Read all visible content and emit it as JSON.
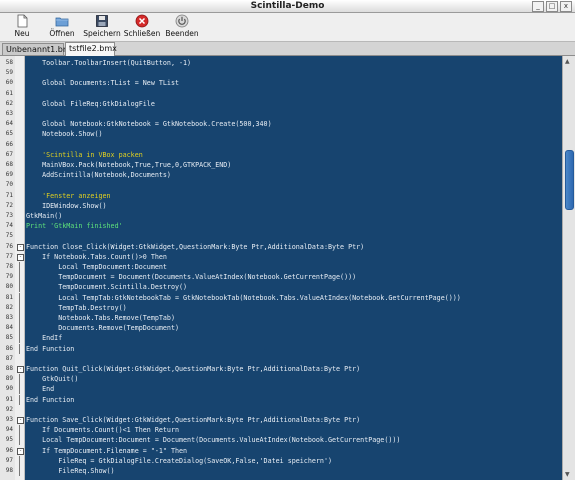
{
  "window": {
    "title": "Scintilla-Demo",
    "buttons": [
      "_",
      "□",
      "x"
    ]
  },
  "toolbar": {
    "items": [
      {
        "label": "Neu",
        "icon": "new-document-icon"
      },
      {
        "label": "Öffnen",
        "icon": "open-folder-icon"
      },
      {
        "label": "Speichern",
        "icon": "save-disk-icon"
      },
      {
        "label": "Schließen",
        "icon": "close-circle-icon"
      },
      {
        "label": "Beenden",
        "icon": "power-icon"
      }
    ]
  },
  "tabs": [
    {
      "label": "Unbenannt1.bmx",
      "active": false
    },
    {
      "label": "tstfile2.bmx",
      "active": true
    }
  ],
  "editor": {
    "colors": {
      "background": "#17446f",
      "text": "#e8eef5",
      "comment": "#e0d020",
      "string": "#5ee07a"
    },
    "lines": [
      {
        "num": "58",
        "text": "\tToolbar.ToolbarInsert(QuitButton, -1)",
        "kind": "code"
      },
      {
        "num": "59",
        "text": "",
        "kind": "code"
      },
      {
        "num": "60",
        "text": "\tGlobal Documents:TList = New TList",
        "kind": "code"
      },
      {
        "num": "61",
        "text": "",
        "kind": "code"
      },
      {
        "num": "62",
        "text": "\tGlobal FileReq:GtkDialogFile",
        "kind": "code"
      },
      {
        "num": "63",
        "text": "",
        "kind": "code"
      },
      {
        "num": "64",
        "text": "\tGlobal Notebook:GtkNotebook = GtkNotebook.Create(500,340)",
        "kind": "code"
      },
      {
        "num": "65",
        "text": "\tNotebook.Show()",
        "kind": "code"
      },
      {
        "num": "66",
        "text": "",
        "kind": "code"
      },
      {
        "num": "67",
        "text": "\t'Scintilla in VBox packen",
        "kind": "comment"
      },
      {
        "num": "68",
        "text": "\tMainVBox.Pack(Notebook,True,True,0,GTKPACK_END)",
        "kind": "code"
      },
      {
        "num": "69",
        "text": "\tAddScintilla(Notebook,Documents)",
        "kind": "code"
      },
      {
        "num": "70",
        "text": "",
        "kind": "code"
      },
      {
        "num": "71",
        "text": "\t'Fenster anzeigen",
        "kind": "comment"
      },
      {
        "num": "72",
        "text": "\tIDEWindow.Show()",
        "kind": "code"
      },
      {
        "num": "73",
        "text": "GtkMain()",
        "kind": "code"
      },
      {
        "num": "74",
        "text": "Print 'GtkMain finished'",
        "kind": "string"
      },
      {
        "num": "75",
        "text": "",
        "kind": "code"
      },
      {
        "num": "76",
        "text": "Function Close_Click(Widget:GtkWidget,QuestionMark:Byte Ptr,AdditionalData:Byte Ptr)",
        "kind": "code",
        "fold": "-"
      },
      {
        "num": "77",
        "text": "\tIf Notebook.Tabs.Count()>0 Then",
        "kind": "code",
        "fold": "-"
      },
      {
        "num": "78",
        "text": "\t\tLocal TempDocument:Document",
        "kind": "code"
      },
      {
        "num": "79",
        "text": "\t\tTempDocument = Document(Documents.ValueAtIndex(Notebook.GetCurrentPage()))",
        "kind": "code"
      },
      {
        "num": "80",
        "text": "\t\tTempDocument.Scintilla.Destroy()",
        "kind": "code"
      },
      {
        "num": "81",
        "text": "\t\tLocal TempTab:GtkNotebookTab = GtkNotebookTab(Notebook.Tabs.ValueAtIndex(Notebook.GetCurrentPage()))",
        "kind": "code"
      },
      {
        "num": "82",
        "text": "\t\tTempTab.Destroy()",
        "kind": "code"
      },
      {
        "num": "83",
        "text": "\t\tNotebook.Tabs.Remove(TempTab)",
        "kind": "code"
      },
      {
        "num": "84",
        "text": "\t\tDocuments.Remove(TempDocument)",
        "kind": "code"
      },
      {
        "num": "85",
        "text": "\tEndIf",
        "kind": "code"
      },
      {
        "num": "86",
        "text": "End Function",
        "kind": "code"
      },
      {
        "num": "87",
        "text": "",
        "kind": "code"
      },
      {
        "num": "88",
        "text": "Function Quit_Click(Widget:GtkWidget,QuestionMark:Byte Ptr,AdditionalData:Byte Ptr)",
        "kind": "code",
        "fold": "-"
      },
      {
        "num": "89",
        "text": "\tGtkQuit()",
        "kind": "code"
      },
      {
        "num": "90",
        "text": "\tEnd",
        "kind": "code"
      },
      {
        "num": "91",
        "text": "End Function",
        "kind": "code"
      },
      {
        "num": "92",
        "text": "",
        "kind": "code"
      },
      {
        "num": "93",
        "text": "Function Save_Click(Widget:GtkWidget,QuestionMark:Byte Ptr,AdditionalData:Byte Ptr)",
        "kind": "code",
        "fold": "-"
      },
      {
        "num": "94",
        "text": "\tIf Documents.Count()<1 Then Return",
        "kind": "code"
      },
      {
        "num": "95",
        "text": "\tLocal TempDocument:Document = Document(Documents.ValueAtIndex(Notebook.GetCurrentPage()))",
        "kind": "code"
      },
      {
        "num": "96",
        "text": "\tIf TempDocument.Filename = \"-1\" Then",
        "kind": "code",
        "fold": "-"
      },
      {
        "num": "97",
        "text": "\t\tFileReq = GtkDialogFile.CreateDialog(SaveOK,False,'Datei speichern')",
        "kind": "code"
      },
      {
        "num": "98",
        "text": "\t\tFileReq.Show()",
        "kind": "code"
      }
    ]
  }
}
